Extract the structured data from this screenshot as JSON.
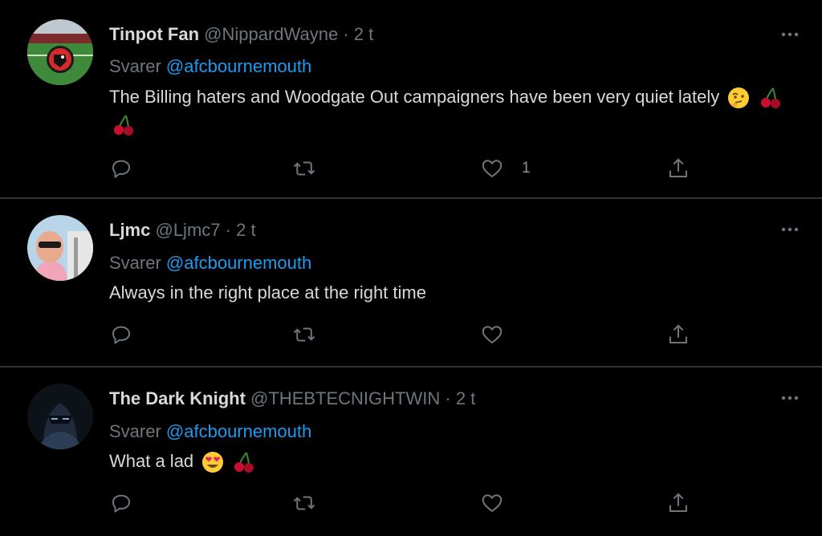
{
  "colors": {
    "background": "#000000",
    "text": "#d9d9d9",
    "muted": "#6e767d",
    "link": "#1d9bf0",
    "divider": "#2f3336"
  },
  "tweets": [
    {
      "name": "Tinpot Fan",
      "handle": "@NippardWayne",
      "dot": "·",
      "time": "2 t",
      "reply_prefix": "Svarer",
      "reply_to": "@afcbournemouth",
      "text": "The Billing haters and Woodgate Out campaigners have been very quiet lately",
      "emojis": [
        "thinking-face-emoji",
        "cherries-emoji",
        "cherries-emoji"
      ],
      "likes": "1",
      "avatar": "stadium-avatar"
    },
    {
      "name": "Ljmc",
      "handle": "@Ljmc7",
      "dot": "·",
      "time": "2 t",
      "reply_prefix": "Svarer",
      "reply_to": "@afcbournemouth",
      "text": "Always in the right place at the right time",
      "emojis": [],
      "likes": "",
      "avatar": "man-sunglasses-avatar"
    },
    {
      "name": "The Dark Knight",
      "handle": "@THEBTECNIGHTWIN",
      "dot": "·",
      "time": "2 t",
      "reply_prefix": "Svarer",
      "reply_to": "@afcbournemouth",
      "text": "What a lad",
      "emojis": [
        "heart-eyes-emoji",
        "cherries-emoji"
      ],
      "likes": "",
      "avatar": "masked-hero-avatar"
    }
  ],
  "action_icons": [
    "reply-icon",
    "retweet-icon",
    "like-icon",
    "share-icon"
  ],
  "more_icon": "more-options-icon"
}
